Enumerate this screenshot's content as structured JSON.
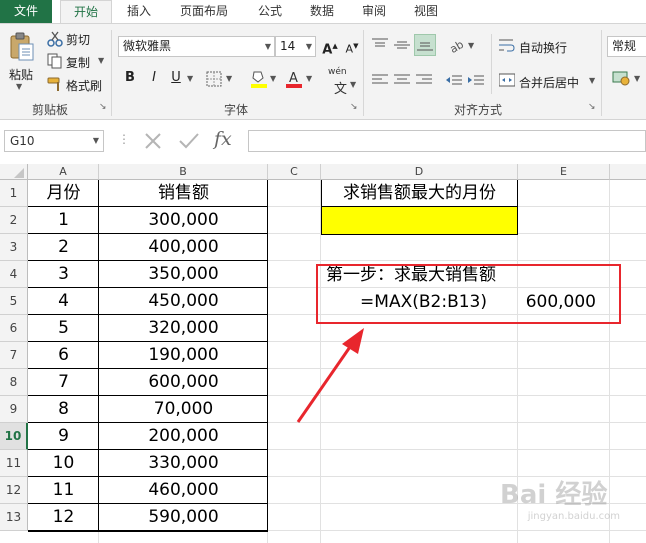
{
  "ribbon": {
    "tabs": [
      "文件",
      "开始",
      "插入",
      "页面布局",
      "公式",
      "数据",
      "审阅",
      "视图"
    ],
    "active_tab": "开始",
    "clipboard": {
      "paste": "粘贴",
      "cut": "剪切",
      "copy": "复制",
      "format_painter": "格式刷",
      "group_label": "剪贴板"
    },
    "font": {
      "font_name": "微软雅黑",
      "font_size": "14",
      "bold": "B",
      "italic": "I",
      "underline": "U",
      "group_label": "字体",
      "wen": "wén"
    },
    "alignment": {
      "wrap_text": "自动换行",
      "merge_center": "合并后居中",
      "group_label": "对齐方式"
    },
    "number": {
      "format": "常规"
    }
  },
  "formula_bar": {
    "name_box": "G10",
    "fx": "fx",
    "value": ""
  },
  "grid": {
    "columns": [
      "A",
      "B",
      "C",
      "D",
      "E"
    ],
    "rows": [
      "1",
      "2",
      "3",
      "4",
      "5",
      "6",
      "7",
      "8",
      "9",
      "10",
      "11",
      "12",
      "13"
    ],
    "selected_row": "10",
    "table_headers": {
      "month": "月份",
      "sales": "销售额"
    },
    "months": [
      "1",
      "2",
      "3",
      "4",
      "5",
      "6",
      "7",
      "8",
      "9",
      "10",
      "11",
      "12"
    ],
    "sales": [
      "300,000",
      "400,000",
      "350,000",
      "450,000",
      "320,000",
      "190,000",
      "600,000",
      "70,000",
      "200,000",
      "330,000",
      "460,000",
      "590,000"
    ],
    "question_title": "求销售额最大的月份",
    "step1_label": "第一步：求最大销售额",
    "step1_formula": "=MAX(B2:B13)",
    "step1_result": "600,000"
  },
  "colors": {
    "excel_green": "#217346",
    "highlight_yellow": "#ffff00",
    "annotation_red": "#e8262d"
  },
  "watermark": {
    "text": "Bai 经验",
    "url": "jingyan.baidu.com"
  }
}
